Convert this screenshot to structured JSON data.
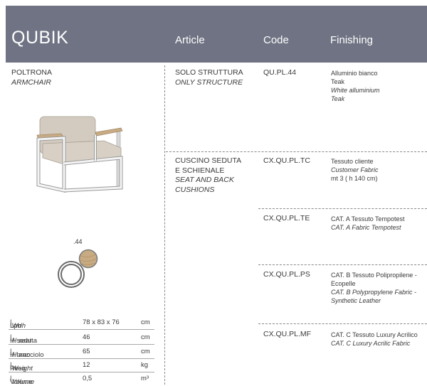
{
  "header": {
    "title": "QUBIK",
    "col_article": "Article",
    "col_code": "Code",
    "col_finishing": "Finishing"
  },
  "product": {
    "name_it": "POLTRONA",
    "name_en": "ARMCHAIR",
    "finish_code_label": ".44"
  },
  "items": [
    {
      "article_it": "SOLO STRUTTURA",
      "article_en": "ONLY STRUCTURE",
      "code": "QU.PL.44",
      "finishing": [
        "Alluminio bianco",
        "Teak"
      ],
      "finishing_en": [
        "White alluminium",
        "Teak"
      ]
    },
    {
      "article_it_1": "CUSCINO SEDUTA",
      "article_it_2": "E SCHIENALE",
      "article_en_1": "SEAT AND BACK",
      "article_en_2": "CUSHIONS",
      "code": "CX.QU.PL.TC",
      "finishing_1": "Tessuto cliente",
      "finishing_2": "Customer Fabric",
      "finishing_3": "mt 3 ( h 140 cm)"
    },
    {
      "code": "CX.QU.PL.TE",
      "finishing_1": "CAT. A Tessuto Tempotest",
      "finishing_2": "CAT. A Fabric Tempotest"
    },
    {
      "code": "CX.QU.PL.PS",
      "finishing_1": "CAT. B Tessuto Polipropilene -",
      "finishing_2": "Ecopelle",
      "finishing_3": "CAT. B Polypropylene Fabric -",
      "finishing_4": "Synthetic Leather"
    },
    {
      "code": "CX.QU.PL.MF",
      "finishing_1": "CAT. C Tessuto Luxury Acrilico",
      "finishing_2": "CAT. C Luxury Acrilic Fabric"
    }
  ],
  "specs": [
    {
      "label_it": "Lph",
      "label_en": "Wdh",
      "value": "78 x 83 x 76",
      "unit": "cm"
    },
    {
      "label_it": "H seduta",
      "label_en": "H seat",
      "value": "46",
      "unit": "cm"
    },
    {
      "label_it": "H bracciolo",
      "label_en": "H arm",
      "value": "65",
      "unit": "cm"
    },
    {
      "label_it": "Peso",
      "label_en": "Weight",
      "value": "12",
      "unit": "kg"
    },
    {
      "label_it": "Volume",
      "label_en": "Volume",
      "value": "0,5",
      "unit": "m³"
    }
  ],
  "colors": {
    "header_bg": "#6f7383",
    "teak": "#c8ab83",
    "cushion": "#d6cec3",
    "frame": "#f2f2f2"
  },
  "icons": [
    "armchair-image",
    "teak-swatch-icon",
    "white-swatch-icon"
  ]
}
